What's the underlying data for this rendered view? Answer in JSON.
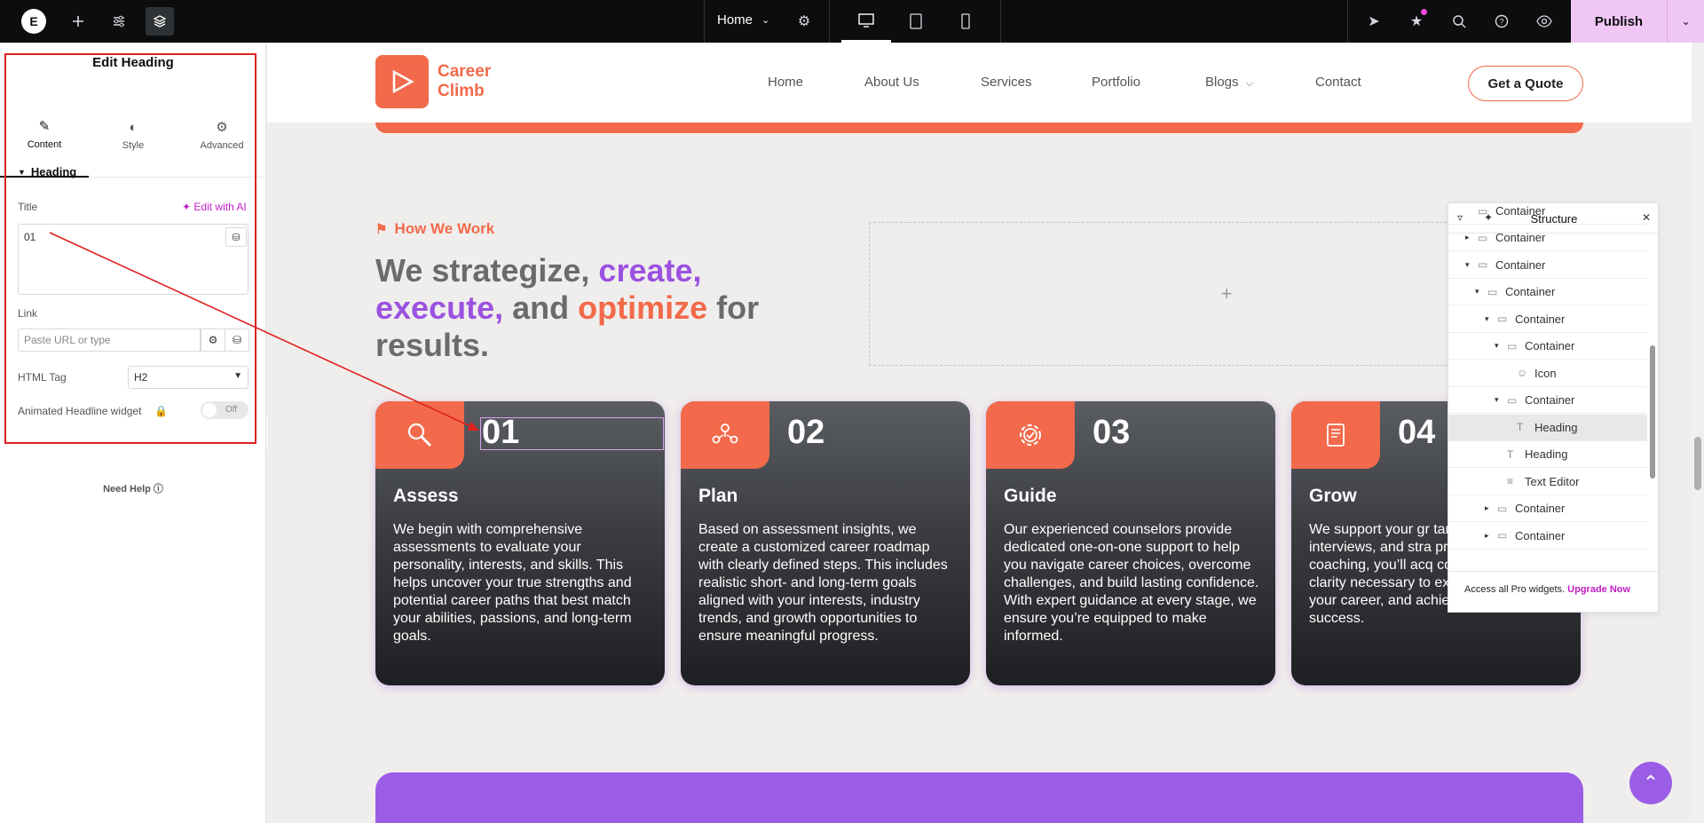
{
  "topbar": {
    "logo": "E",
    "page_name": "Home",
    "publish_label": "Publish",
    "colors": {
      "bg": "#0c0d0e",
      "publish": "#f0c6f4"
    }
  },
  "panel": {
    "title": "Edit Heading",
    "tabs": [
      {
        "label": "Content",
        "icon": "pencil-icon"
      },
      {
        "label": "Style",
        "icon": "half-circle-icon"
      },
      {
        "label": "Advanced",
        "icon": "gear-icon"
      }
    ],
    "section": "Heading",
    "title_label": "Title",
    "edit_ai_label": "Edit with AI",
    "title_value": "01",
    "link_label": "Link",
    "link_placeholder": "Paste URL or type",
    "html_tag_label": "HTML Tag",
    "html_tag_value": "H2",
    "animated_label": "Animated Headline widget",
    "toggle_label": "Off",
    "need_help": "Need Help"
  },
  "site": {
    "brand_line1": "Career",
    "brand_line2": "Climb",
    "nav": [
      "Home",
      "About Us",
      "Services",
      "Portfolio",
      "Blogs",
      "Contact"
    ],
    "quote_button": "Get a Quote",
    "eyebrow": "How We Work",
    "headline": {
      "part1": "We strategize, ",
      "part2": "create,",
      "part3": "execute,",
      "part4": " and ",
      "part5": "optimize",
      "part6": " for results."
    },
    "drop_plus": "+",
    "cards": [
      {
        "num": "01",
        "title": "Assess",
        "icon": "magnifier-icon",
        "desc": "We begin with comprehensive assessments to evaluate your personality, interests, and skills. This helps uncover your true strengths and potential career paths that best match your abilities, passions, and long-term goals."
      },
      {
        "num": "02",
        "title": "Plan",
        "icon": "team-icon",
        "desc": "Based on assessment insights, we create a customized career roadmap with clearly defined steps. This includes realistic short- and long-term goals aligned with your interests, industry trends, and growth opportunities to ensure meaningful progress."
      },
      {
        "num": "03",
        "title": "Guide",
        "icon": "gear-check-icon",
        "desc": "Our experienced counselors provide dedicated one-on-one support to help you navigate career choices, overcome challenges, and build lasting confidence. With expert guidance at every stage, we ensure you’re equipped to make informed."
      },
      {
        "num": "04",
        "title": "Grow",
        "icon": "document-icon",
        "desc": "We support your gr targeted skill develo interviews, and stra preparation. Throug coaching, you’ll acq confidence, and clarity necessary to excel, advance in your career, and achieve professional success."
      }
    ],
    "colors": {
      "orange": "#f26a4b",
      "purple": "#9b52e0"
    }
  },
  "structure": {
    "title": "Structure",
    "rows": [
      {
        "label": "Container",
        "caret": "",
        "icon": "container-icon",
        "indent": 1
      },
      {
        "label": "Container",
        "caret": "▸",
        "icon": "container-icon",
        "indent": 1
      },
      {
        "label": "Container",
        "caret": "▾",
        "icon": "container-icon",
        "indent": 1
      },
      {
        "label": "Container",
        "caret": "▾",
        "icon": "container-icon",
        "indent": 2
      },
      {
        "label": "Container",
        "caret": "▾",
        "icon": "container-icon",
        "indent": 3
      },
      {
        "label": "Container",
        "caret": "▾",
        "icon": "container-icon",
        "indent": 4
      },
      {
        "label": "Icon",
        "caret": "",
        "icon": "icon-widget-icon",
        "indent": 5
      },
      {
        "label": "Container",
        "caret": "▾",
        "icon": "container-icon",
        "indent": 4
      },
      {
        "label": "Heading",
        "caret": "",
        "icon": "heading-icon",
        "indent": 5,
        "selected": true
      },
      {
        "label": "Heading",
        "caret": "",
        "icon": "heading-icon",
        "indent": 4
      },
      {
        "label": "Text Editor",
        "caret": "",
        "icon": "text-editor-icon",
        "indent": 4
      },
      {
        "label": "Container",
        "caret": "▸",
        "icon": "container-icon",
        "indent": 3
      },
      {
        "label": "Container",
        "caret": "▸",
        "icon": "container-icon",
        "indent": 3
      }
    ],
    "footer_text": "Access all Pro widgets.",
    "footer_link": "Upgrade Now"
  }
}
